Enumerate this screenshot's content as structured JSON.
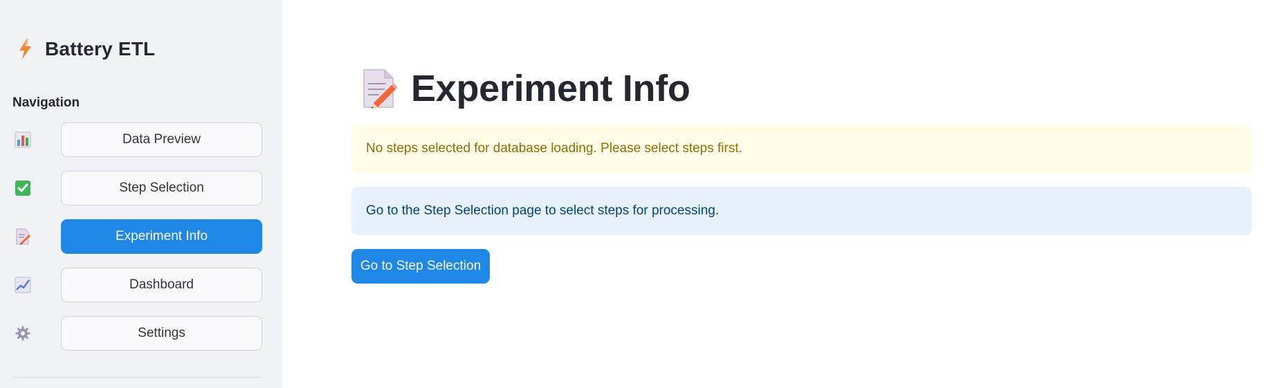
{
  "sidebar": {
    "brand": {
      "title": "Battery ETL",
      "icon": "lightning-icon"
    },
    "nav_heading": "Navigation",
    "items": [
      {
        "label": "Data Preview",
        "icon": "bar-chart-icon",
        "active": false
      },
      {
        "label": "Step Selection",
        "icon": "checkbox-icon",
        "active": false
      },
      {
        "label": "Experiment Info",
        "icon": "memo-icon",
        "active": true
      },
      {
        "label": "Dashboard",
        "icon": "trend-chart-icon",
        "active": false
      },
      {
        "label": "Settings",
        "icon": "gear-icon",
        "active": false
      }
    ]
  },
  "main": {
    "title": "Experiment Info",
    "title_icon": "memo-icon",
    "warning": "No steps selected for database loading. Please select steps first.",
    "info": "Go to the Step Selection page to select steps for processing.",
    "action_button": "Go to Step Selection"
  },
  "colors": {
    "primary": "#1f87e5",
    "sidebar_bg": "#f0f2f6",
    "warning_bg": "#fffce7",
    "warning_text": "#926c05",
    "info_bg": "#e8f2fc",
    "info_text": "#004280"
  }
}
